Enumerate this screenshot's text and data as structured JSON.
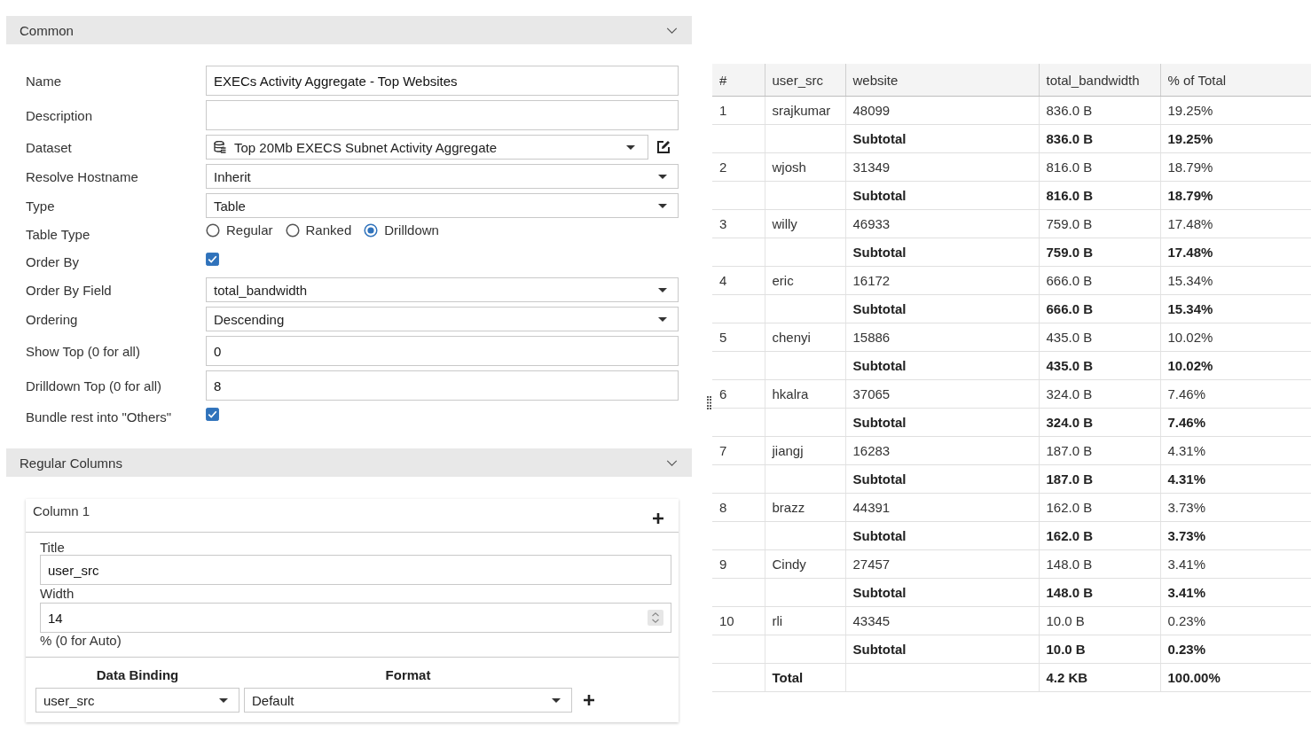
{
  "common": {
    "title": "Common",
    "expanded": true,
    "fields": [
      {
        "kind": "text",
        "label": "Name",
        "value": "EXECs Activity Aggregate - Top Websites"
      },
      {
        "kind": "text",
        "label": "Description"
      },
      {
        "kind": "dataset",
        "label": "Dataset",
        "value": "Top 20Mb EXECS Subnet Activity Aggregate"
      },
      {
        "kind": "select",
        "label": "Resolve Hostname",
        "value": "Inherit"
      },
      {
        "kind": "select",
        "label": "Type",
        "value": "Table"
      },
      {
        "kind": "radio",
        "label": "Table Type",
        "options": [
          {
            "label": "Regular",
            "selected": false
          },
          {
            "label": "Ranked",
            "selected": false
          },
          {
            "label": "Drilldown",
            "selected": true
          }
        ]
      },
      {
        "kind": "checkbox",
        "label": "Order By",
        "checked": true
      },
      {
        "kind": "select",
        "label": "Order By Field",
        "value": "total_bandwidth"
      },
      {
        "kind": "select",
        "label": "Ordering",
        "value": "Descending"
      },
      {
        "kind": "text",
        "label": "Show Top (0 for all)",
        "value": "0"
      },
      {
        "kind": "text",
        "label": "Drilldown Top (0 for all)",
        "value": "8"
      },
      {
        "kind": "checkbox",
        "label": "Bundle rest into \"Others\"",
        "checked": true
      }
    ]
  },
  "regular_columns": {
    "title": "Regular Columns",
    "expanded": true,
    "columns": [
      {
        "title": "Column 1",
        "title_label": "Title",
        "title_value": "user_src",
        "width_label": "Width",
        "width_value": "14",
        "width_hint": "% (0 for Auto)",
        "binding_header": "Data Binding",
        "format_header": "Format",
        "binding": "user_src",
        "format": "Default"
      }
    ]
  },
  "table": {
    "columns": [
      "#",
      "user_src",
      "website",
      "total_bandwidth",
      "% of Total"
    ],
    "rows": [
      {
        "kind": "data",
        "cells": [
          "1",
          "srajkumar",
          "48099",
          "836.0 B",
          "19.25%"
        ]
      },
      {
        "kind": "subtotal",
        "label": "Subtotal",
        "bandwidth": "836.0 B",
        "percent": "19.25%"
      },
      {
        "kind": "data",
        "cells": [
          "2",
          "wjosh",
          "31349",
          "816.0 B",
          "18.79%"
        ]
      },
      {
        "kind": "subtotal",
        "label": "Subtotal",
        "bandwidth": "816.0 B",
        "percent": "18.79%"
      },
      {
        "kind": "data",
        "cells": [
          "3",
          "willy",
          "46933",
          "759.0 B",
          "17.48%"
        ]
      },
      {
        "kind": "subtotal",
        "label": "Subtotal",
        "bandwidth": "759.0 B",
        "percent": "17.48%"
      },
      {
        "kind": "data",
        "cells": [
          "4",
          "eric",
          "16172",
          "666.0 B",
          "15.34%"
        ]
      },
      {
        "kind": "subtotal",
        "label": "Subtotal",
        "bandwidth": "666.0 B",
        "percent": "15.34%"
      },
      {
        "kind": "data",
        "cells": [
          "5",
          "chenyi",
          "15886",
          "435.0 B",
          "10.02%"
        ]
      },
      {
        "kind": "subtotal",
        "label": "Subtotal",
        "bandwidth": "435.0 B",
        "percent": "10.02%"
      },
      {
        "kind": "data",
        "cells": [
          "6",
          "hkalra",
          "37065",
          "324.0 B",
          "7.46%"
        ]
      },
      {
        "kind": "subtotal",
        "label": "Subtotal",
        "bandwidth": "324.0 B",
        "percent": "7.46%"
      },
      {
        "kind": "data",
        "cells": [
          "7",
          "jiangj",
          "16283",
          "187.0 B",
          "4.31%"
        ]
      },
      {
        "kind": "subtotal",
        "label": "Subtotal",
        "bandwidth": "187.0 B",
        "percent": "4.31%"
      },
      {
        "kind": "data",
        "cells": [
          "8",
          "brazz",
          "44391",
          "162.0 B",
          "3.73%"
        ]
      },
      {
        "kind": "subtotal",
        "label": "Subtotal",
        "bandwidth": "162.0 B",
        "percent": "3.73%"
      },
      {
        "kind": "data",
        "cells": [
          "9",
          "Cindy",
          "27457",
          "148.0 B",
          "3.41%"
        ]
      },
      {
        "kind": "subtotal",
        "label": "Subtotal",
        "bandwidth": "148.0 B",
        "percent": "3.41%"
      },
      {
        "kind": "data",
        "cells": [
          "10",
          "rli",
          "43345",
          "10.0 B",
          "0.23%"
        ]
      },
      {
        "kind": "subtotal",
        "label": "Subtotal",
        "bandwidth": "10.0 B",
        "percent": "0.23%"
      },
      {
        "kind": "total",
        "label": "Total",
        "bandwidth": "4.2 KB",
        "percent": "100.00%"
      }
    ]
  }
}
